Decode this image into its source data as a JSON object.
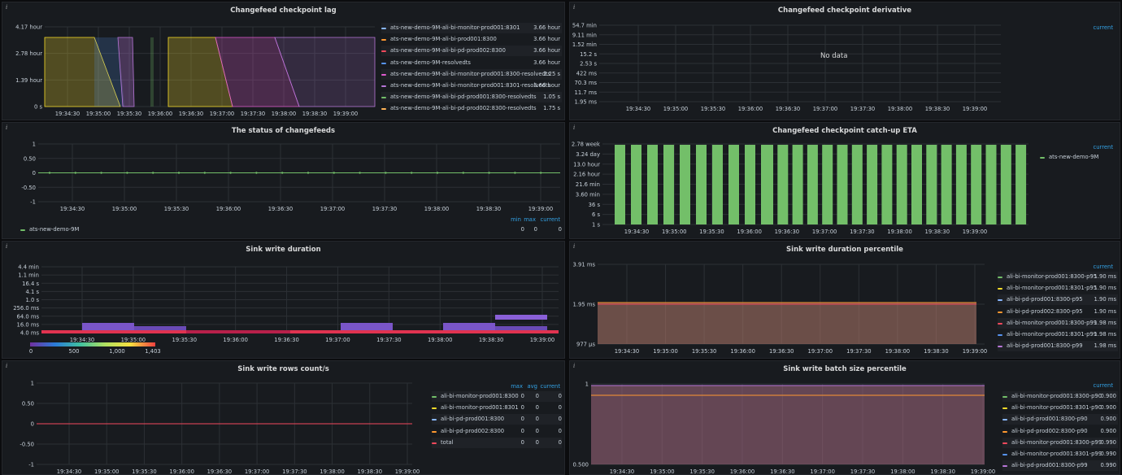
{
  "colors": {
    "cyan": "#8ab8ff",
    "orange": "#ff9830",
    "red": "#f2495c",
    "blue": "#5794f2",
    "purple": "#b877d9",
    "green": "#73bf69",
    "yellow": "#fade2a",
    "peach": "#ffb357",
    "magenta": "#e05bd0",
    "lblue": "#8ab8ff"
  },
  "time_ticks": [
    "19:34:30",
    "19:35:00",
    "19:35:30",
    "19:36:00",
    "19:36:30",
    "19:37:00",
    "19:37:30",
    "19:38:00",
    "19:38:30",
    "19:39:00"
  ],
  "panels": {
    "lag": {
      "title": "Changefeed checkpoint lag",
      "y_ticks": [
        "4.17 hour",
        "2.78 hour",
        "1.39 hour",
        "0 s"
      ],
      "legend": [
        {
          "name": "ats-new-demo-9M-ali-bi-monitor-prod001:8301",
          "value": "3.66 hour",
          "color": "#8ab8ff"
        },
        {
          "name": "ats-new-demo-9M-ali-bi-prod001:8300",
          "value": "3.66 hour",
          "color": "#ff9830"
        },
        {
          "name": "ats-new-demo-9M-ali-bi-pd-prod002:8300",
          "value": "3.66 hour",
          "color": "#f2495c"
        },
        {
          "name": "ats-new-demo-9M-resolvedts",
          "value": "3.66 hour",
          "color": "#5794f2"
        },
        {
          "name": "ats-new-demo-9M-ali-bi-monitor-prod001:8300-resolvedts",
          "value": "2.25 s",
          "color": "#e05bd0"
        },
        {
          "name": "ats-new-demo-9M-ali-bi-monitor-prod001:8301-resolvedts",
          "value": "3.66 hour",
          "color": "#b877d9"
        },
        {
          "name": "ats-new-demo-9M-ali-bi-pd-prod001:8300-resolvedts",
          "value": "1.05 s",
          "color": "#73bf69"
        },
        {
          "name": "ats-new-demo-9M-ali-bi-pd-prod002:8300-resolvedts",
          "value": "1.75 s",
          "color": "#ffb357"
        }
      ]
    },
    "derivative": {
      "title": "Changefeed checkpoint derivative",
      "y_ticks": [
        "54.7 min",
        "9.11 min",
        "1.52 min",
        "15.2 s",
        "2.53 s",
        "422 ms",
        "70.3 ms",
        "11.7 ms",
        "1.95 ms"
      ],
      "no_data": "No data",
      "legend_header": "current"
    },
    "status": {
      "title": "The status of changefeeds",
      "y_ticks": [
        "1",
        "0.50",
        "0",
        "-0.50",
        "-1"
      ],
      "legend_headers": [
        "min",
        "max",
        "current"
      ],
      "legend": [
        {
          "name": "ats-new-demo-9M",
          "min": "0",
          "max": "0",
          "current": "0",
          "color": "#73bf69"
        }
      ]
    },
    "eta": {
      "title": "Changefeed checkpoint catch-up ETA",
      "y_ticks": [
        "2.78 week",
        "3.24 day",
        "13.0 hour",
        "2.16 hour",
        "21.6 min",
        "3.60 min",
        "36 s",
        "6 s",
        "1 s"
      ],
      "legend_header": "current",
      "legend": [
        {
          "name": "ats-new-demo-9M",
          "color": "#73bf69"
        }
      ]
    },
    "sink_dur": {
      "title": "Sink write duration",
      "y_ticks": [
        "4.4 min",
        "1.1 min",
        "16.4 s",
        "4.1 s",
        "1.0 s",
        "256.0 ms",
        "64.0 ms",
        "16.0 ms",
        "4.0 ms"
      ],
      "scale_labels": [
        "0",
        "500",
        "1,000",
        "1,403"
      ]
    },
    "sink_pct": {
      "title": "Sink write duration percentile",
      "y_ticks": [
        "3.91 ms",
        "1.95 ms",
        "977 µs"
      ],
      "legend_header": "current",
      "legend": [
        {
          "name": "ali-bi-monitor-prod001:8300-p95",
          "value": "1.90 ms",
          "color": "#73bf69"
        },
        {
          "name": "ali-bi-monitor-prod001:8301-p95",
          "value": "1.90 ms",
          "color": "#fade2a"
        },
        {
          "name": "ali-bi-pd-prod001:8300-p95",
          "value": "1.90 ms",
          "color": "#8ab8ff"
        },
        {
          "name": "ali-bi-pd-prod002:8300-p95",
          "value": "1.90 ms",
          "color": "#ff9830"
        },
        {
          "name": "ali-bi-monitor-prod001:8300-p99",
          "value": "1.98 ms",
          "color": "#f2495c"
        },
        {
          "name": "ali-bi-monitor-prod001:8301-p99",
          "value": "1.98 ms",
          "color": "#5794f2"
        },
        {
          "name": "ali-bi-pd-prod001:8300-p99",
          "value": "1.98 ms",
          "color": "#b877d9"
        }
      ]
    },
    "rows": {
      "title": "Sink write rows count/s",
      "y_ticks": [
        "1",
        "0.50",
        "0",
        "-0.50",
        "-1"
      ],
      "legend_headers": [
        "max",
        "avg",
        "current"
      ],
      "legend": [
        {
          "name": "ali-bi-monitor-prod001:8300",
          "max": "0",
          "avg": "0",
          "current": "0",
          "color": "#73bf69"
        },
        {
          "name": "ali-bi-monitor-prod001:8301",
          "max": "0",
          "avg": "0",
          "current": "0",
          "color": "#fade2a"
        },
        {
          "name": "ali-bi-pd-prod001:8300",
          "max": "0",
          "avg": "0",
          "current": "0",
          "color": "#8ab8ff"
        },
        {
          "name": "ali-bi-pd-prod002:8300",
          "max": "0",
          "avg": "0",
          "current": "0",
          "color": "#ff9830"
        },
        {
          "name": "total",
          "max": "0",
          "avg": "0",
          "current": "0",
          "color": "#f2495c"
        }
      ]
    },
    "batch": {
      "title": "Sink write batch size percentile",
      "y_ticks": [
        "1",
        "0.500"
      ],
      "legend_header": "current",
      "legend": [
        {
          "name": "ali-bi-monitor-prod001:8300-p90",
          "value": "0.900",
          "color": "#73bf69"
        },
        {
          "name": "ali-bi-monitor-prod001:8301-p90",
          "value": "0.900",
          "color": "#fade2a"
        },
        {
          "name": "ali-bi-pd-prod001:8300-p90",
          "value": "0.900",
          "color": "#8ab8ff"
        },
        {
          "name": "ali-bi-pd-prod002:8300-p90",
          "value": "0.900",
          "color": "#ff9830"
        },
        {
          "name": "ali-bi-monitor-prod001:8300-p99",
          "value": "0.990",
          "color": "#f2495c"
        },
        {
          "name": "ali-bi-monitor-prod001:8301-p99",
          "value": "0.990",
          "color": "#5794f2"
        },
        {
          "name": "ali-bi-pd-prod001:8300-p99",
          "value": "0.990",
          "color": "#b877d9"
        }
      ]
    }
  }
}
